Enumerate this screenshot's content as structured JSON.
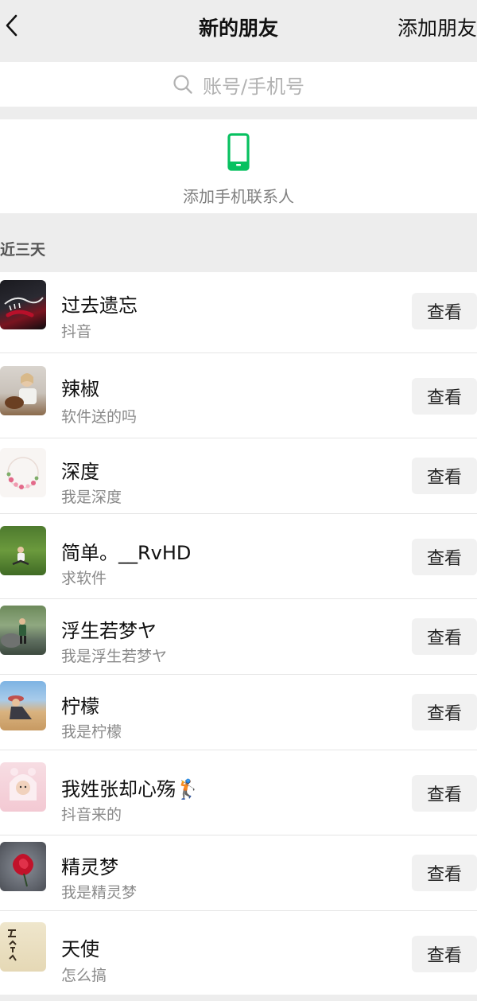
{
  "header": {
    "title": "新的朋友",
    "action_label": "添加朋友"
  },
  "search": {
    "placeholder": "账号/手机号"
  },
  "add_phone": {
    "label": "添加手机联系人"
  },
  "section_title": "近三天",
  "friends": [
    {
      "name": "过去遗忘",
      "note": "抖音",
      "button": "查看"
    },
    {
      "name": "辣椒",
      "note": "软件送的吗",
      "button": "查看"
    },
    {
      "name": "深度",
      "note": "我是深度",
      "button": "查看"
    },
    {
      "name": "简单。__RvHD",
      "note": "求软件",
      "button": "查看"
    },
    {
      "name": "浮生若梦ヤ",
      "note": "我是浮生若梦ヤ",
      "button": "查看"
    },
    {
      "name": "柠檬",
      "note": "我是柠檬",
      "button": "查看"
    },
    {
      "name": "我姓张却心殇🏌️",
      "note": "抖音来的",
      "button": "查看"
    },
    {
      "name": "精灵梦",
      "note": "我是精灵梦",
      "button": "查看"
    },
    {
      "name": "天使",
      "note": "怎么搞",
      "button": "查看"
    }
  ],
  "colors": {
    "background": "#ededed",
    "accent_green": "#07c160",
    "text_primary": "#111111",
    "text_secondary": "#8a8a8a",
    "button_bg": "#f1f1f1"
  },
  "icons": {
    "back": "chevron-left-icon",
    "search": "search-icon",
    "phone": "mobile-phone-icon"
  }
}
